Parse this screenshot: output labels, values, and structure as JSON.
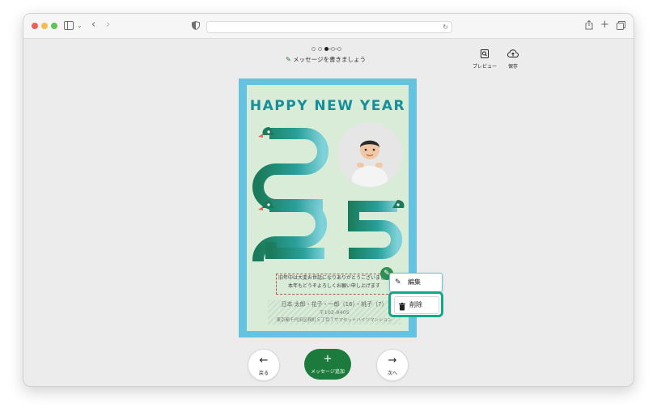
{
  "toolbar": {
    "traffic_lights": [
      "#ee5f57",
      "#f5bd4f",
      "#60c455"
    ],
    "icons": [
      "sidebar-icon",
      "chevron-down-icon",
      "back-arrow-icon",
      "forward-arrow-icon",
      "shield-icon",
      "reload-icon",
      "share-icon",
      "plus-icon",
      "tabs-icon"
    ],
    "address": ""
  },
  "editor": {
    "step_count": 5,
    "current_step": 3,
    "instruction": "メッセージを書きましょう",
    "preview_label": "プレビュー",
    "save_label": "保存"
  },
  "card": {
    "title": "HAPPY NEW YEAR",
    "year": "2025",
    "message_line1": "旧年中は大変お世話になりありがとうございました",
    "message_line2": "本年もどうぞよろしくお願い申し上げます",
    "sender_names": "日本 太郎・花子・一郎（16）・桃子（7）",
    "sender_zip": "〒102-8405",
    "sender_address": "東京都千代田区麹町５丁目７サマセットハイツマンション",
    "frame_color": "#63c3e0",
    "background_color": "#d8ecd8",
    "accent_color": "#178e9a"
  },
  "context_menu": {
    "edit_label": "編集",
    "delete_label": "削除"
  },
  "nav": {
    "back_label": "戻る",
    "add_message_label": "メッセージ追加",
    "next_label": "次へ"
  }
}
